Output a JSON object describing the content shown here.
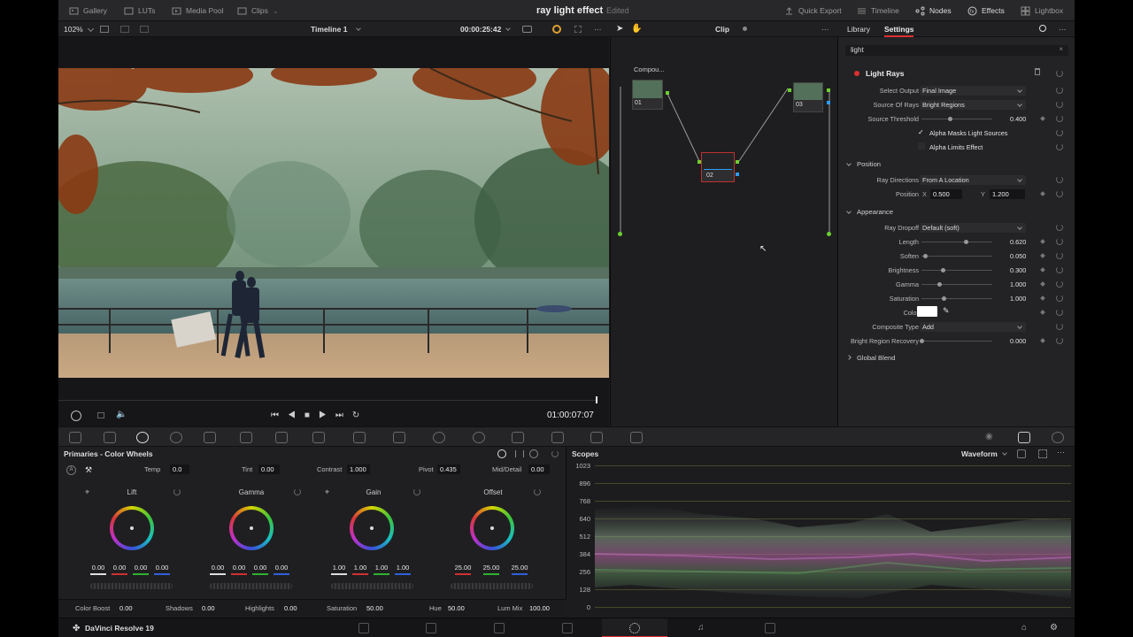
{
  "topbar": {
    "gallery": "Gallery",
    "luts": "LUTs",
    "media_pool": "Media Pool",
    "clips": "Clips",
    "project_title": "ray light effect",
    "project_status": "Edited",
    "quick_export": "Quick Export",
    "timeline": "Timeline",
    "nodes": "Nodes",
    "effects": "Effects",
    "lightbox": "Lightbox"
  },
  "viewer_bar": {
    "zoom": "102%",
    "timeline_name": "Timeline 1",
    "timecode": "00:00:25:42",
    "clip_mode": "Clip"
  },
  "settings_tabs": {
    "library": "Library",
    "settings": "Settings"
  },
  "search": {
    "value": "light"
  },
  "effect": {
    "name": "Light Rays",
    "rows": {
      "select_output": {
        "label": "Select Output",
        "value": "Final Image"
      },
      "source_of_rays": {
        "label": "Source Of Rays",
        "value": "Bright Regions"
      },
      "source_threshold": {
        "label": "Source Threshold",
        "value": "0.400",
        "level": 0.4
      },
      "alpha_masks": {
        "label": "Alpha Masks Light Sources",
        "checked": true
      },
      "alpha_limits": {
        "label": "Alpha Limits Effect",
        "checked": false
      }
    },
    "position_section": {
      "title": "Position",
      "ray_directions": {
        "label": "Ray Directions",
        "value": "From A Location"
      },
      "position": {
        "label": "Position",
        "x_label": "X",
        "x": "0.500",
        "y_label": "Y",
        "y": "1.200"
      }
    },
    "appearance_section": {
      "title": "Appearance",
      "ray_dropoff": {
        "label": "Ray Dropoff",
        "value": "Default (soft)"
      },
      "sliders": [
        {
          "label": "Length",
          "value": "0.620",
          "level": 0.62
        },
        {
          "label": "Soften",
          "value": "0.050",
          "level": 0.05
        },
        {
          "label": "Brightness",
          "value": "0.300",
          "level": 0.3
        },
        {
          "label": "Gamma",
          "value": "1.000",
          "level": 0.25
        },
        {
          "label": "Saturation",
          "value": "1.000",
          "level": 0.31
        }
      ],
      "color": {
        "label": "Color",
        "value": "#ffffff"
      },
      "composite_type": {
        "label": "Composite Type",
        "value": "Add"
      },
      "bright_region_recovery": {
        "label": "Bright Region Recovery",
        "value": "0.000",
        "level": 0.0
      }
    },
    "global_blend": "Global Blend"
  },
  "nodes": {
    "compound_label": "Compou...",
    "node1": "01",
    "node2": "02",
    "node3": "03"
  },
  "transport": {
    "timecode": "01:00:07:07"
  },
  "primaries": {
    "title": "Primaries - Color Wheels",
    "temp_label": "Temp",
    "temp": "0.0",
    "tint_label": "Tint",
    "tint": "0.00",
    "contrast_label": "Contrast",
    "contrast": "1.000",
    "pivot_label": "Pivot",
    "pivot": "0.435",
    "middetail_label": "Mid/Detail",
    "middetail": "0.00",
    "wheels": [
      {
        "name": "Lift",
        "values": [
          "0.00",
          "0.00",
          "0.00",
          "0.00"
        ]
      },
      {
        "name": "Gamma",
        "values": [
          "0.00",
          "0.00",
          "0.00",
          "0.00"
        ]
      },
      {
        "name": "Gain",
        "values": [
          "1.00",
          "1.00",
          "1.00",
          "1.00"
        ]
      },
      {
        "name": "Offset",
        "values": [
          "25.00",
          "25.00",
          "25.00"
        ]
      }
    ],
    "color_boost_label": "Color Boost",
    "color_boost": "0.00",
    "shadows_label": "Shadows",
    "shadows": "0.00",
    "highlights_label": "Highlights",
    "highlights": "0.00",
    "saturation_label": "Saturation",
    "saturation": "50.00",
    "hue_label": "Hue",
    "hue": "50.00",
    "lummix_label": "Lum Mix",
    "lummix": "100.00"
  },
  "scopes": {
    "title": "Scopes",
    "mode": "Waveform",
    "ticks": [
      "1023",
      "896",
      "768",
      "640",
      "512",
      "384",
      "256",
      "128",
      "0"
    ]
  },
  "status": {
    "app_name": "DaVinci Resolve 19"
  },
  "colors": {
    "accent_red": "#e03030",
    "node_green": "#6cd030",
    "node_blue": "#2a9df4"
  }
}
